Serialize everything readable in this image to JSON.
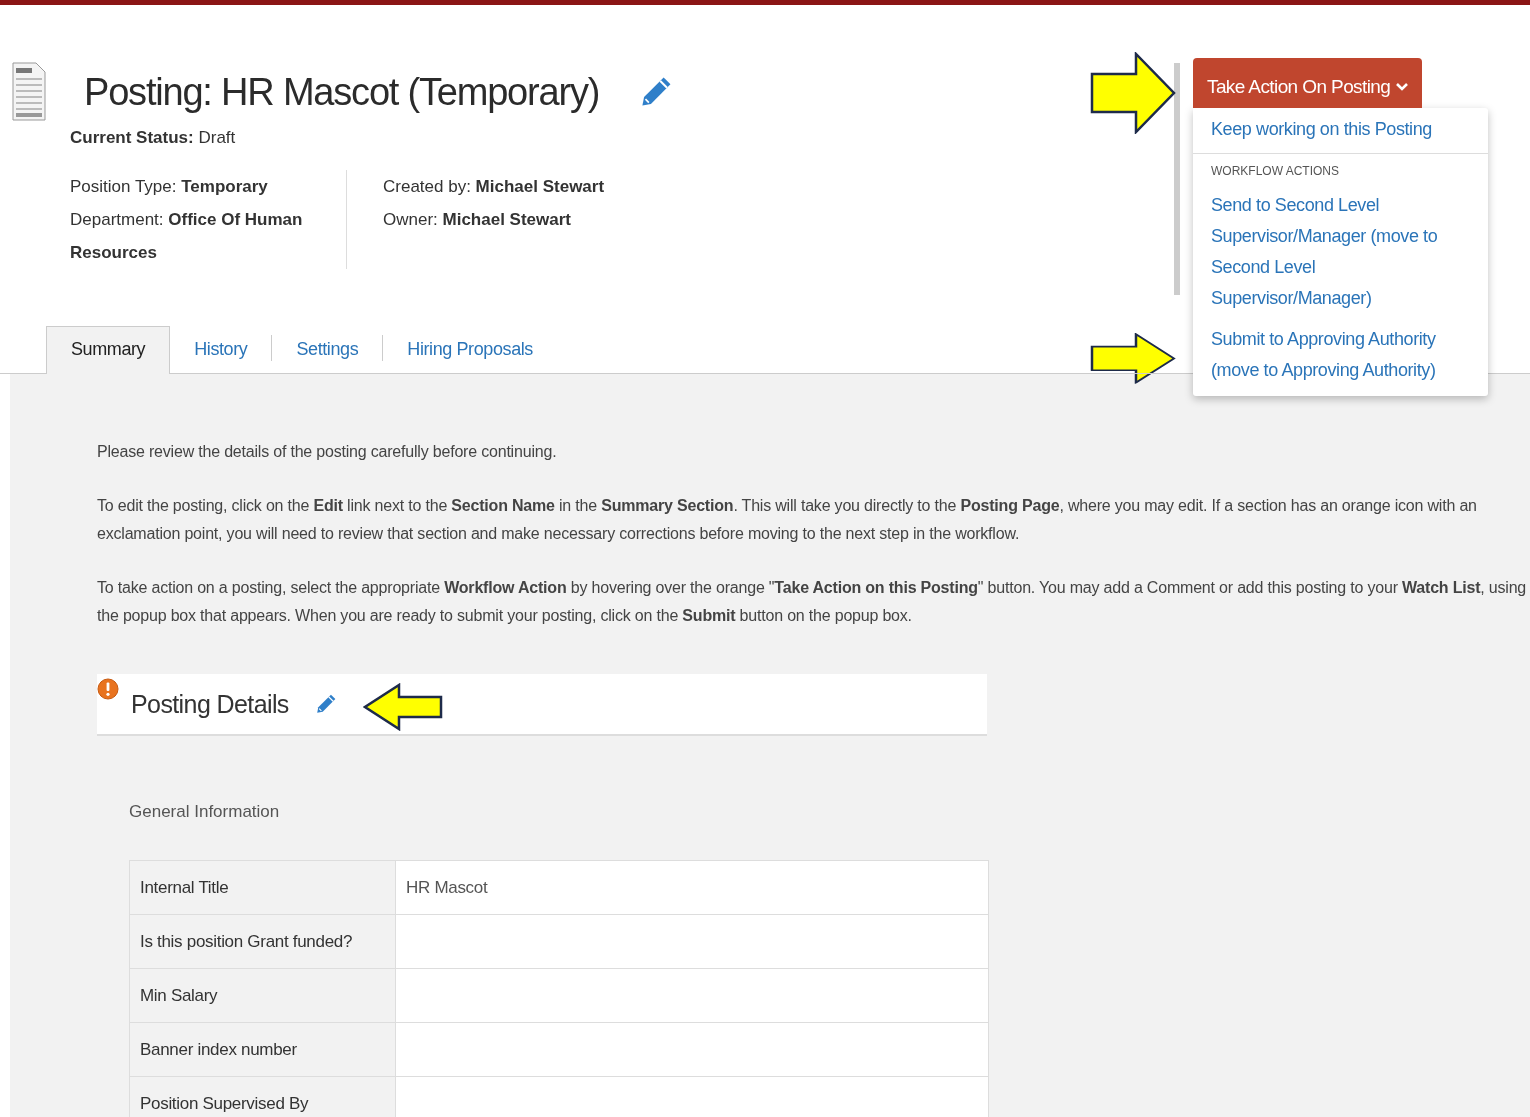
{
  "header": {
    "title": "Posting: HR Mascot (Temporary)",
    "status": "**Current Status:** Draft",
    "meta_columns": [
      [
        "Position Type: **Temporary**",
        "Department: **Office Of Human Resources**"
      ],
      [
        "Created by: **Michael Stewart**",
        "Owner: **Michael Stewart**"
      ]
    ]
  },
  "action_menu": {
    "button": "Take Action On Posting",
    "items": [
      {
        "kind": "link",
        "text": "Keep working on this Posting"
      },
      {
        "kind": "heading",
        "text": "WORKFLOW ACTIONS"
      },
      {
        "kind": "link",
        "text": "Send to Second Level Supervisor/Manager (move to Second Level Supervisor/Manager)"
      },
      {
        "kind": "link",
        "text": "Submit to Approving Authority (move to Approving Authority)"
      }
    ]
  },
  "tabs": [
    {
      "label": "Summary",
      "selected": true
    },
    {
      "label": "History",
      "selected": false
    },
    {
      "label": "Settings",
      "selected": false
    },
    {
      "label": "Hiring Proposals",
      "selected": false
    }
  ],
  "intro": [
    "Please review the details of the posting carefully before continuing.",
    "To edit the posting, click on the **Edit** link next to the **Section Name** in the **Summary Section**. This will take you directly to the **Posting Page**, where you may edit. If a section has an orange icon with an exclamation point, you will need to review that section and make necessary corrections before moving to the next step in the workflow.",
    "To take action on a posting, select the appropriate **Workflow Action** by hovering over the orange \"**Take Action on this Posting**\" button. You may add a Comment or add this posting to your **Watch List**, using the popup box that appears. When you are ready to submit your posting, click on the **Submit** button on the popup box."
  ],
  "section": {
    "title": "Posting Details",
    "warning": true,
    "subtitle": "General Information",
    "rows": [
      {
        "label": "Internal Title",
        "value": "HR Mascot"
      },
      {
        "label": "Is this position Grant funded?"
      },
      {
        "label": "Min Salary"
      },
      {
        "label": "Banner index number"
      },
      {
        "label": "Position Supervised By"
      }
    ]
  }
}
